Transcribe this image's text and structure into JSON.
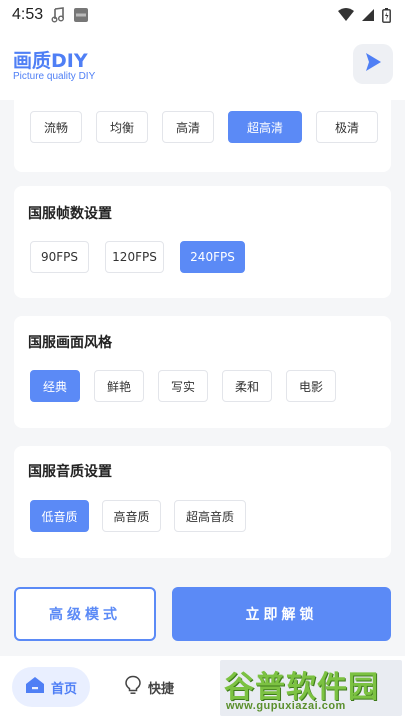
{
  "status_bar": {
    "time": "4:53"
  },
  "header": {
    "title": "画质DIY",
    "subtitle": "Picture quality DIY"
  },
  "sections": {
    "quality": {
      "options": [
        "流畅",
        "均衡",
        "高清",
        "超高清",
        "极清"
      ],
      "selected": "超高清"
    },
    "fps": {
      "title": "国服帧数设置",
      "options": [
        "90FPS",
        "120FPS",
        "240FPS"
      ],
      "selected": "240FPS"
    },
    "style": {
      "title": "国服画面风格",
      "options": [
        "经典",
        "鲜艳",
        "写实",
        "柔和",
        "电影"
      ],
      "selected": "经典"
    },
    "audio": {
      "title": "国服音质设置",
      "options": [
        "低音质",
        "高音质",
        "超高音质"
      ],
      "selected": "低音质"
    }
  },
  "actions": {
    "advanced_label": "高级模式",
    "unlock_label": "立即解锁"
  },
  "bottom_nav": {
    "home_label": "首页",
    "quick_label": "快捷"
  },
  "watermark": {
    "main": "谷普软件园",
    "url": "www.gupuxiazai.com"
  },
  "colors": {
    "accent": "#5b8af6",
    "title_blue": "#4f7ff5",
    "watermark_green": "#7cc242"
  },
  "icons": [
    "music-note-icon",
    "hms-badge-icon",
    "wifi-icon",
    "signal-icon",
    "battery-icon",
    "play-icon",
    "home-icon",
    "lightbulb-icon"
  ]
}
